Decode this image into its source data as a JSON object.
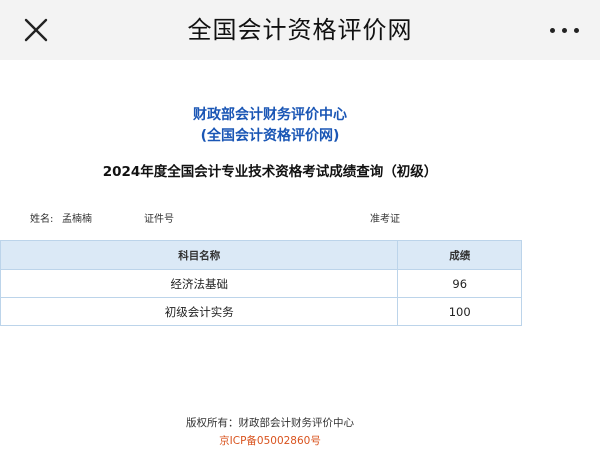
{
  "topbar": {
    "title": "全国会计资格评价网",
    "close_icon": "close-icon",
    "more_icon": "more-dots-icon"
  },
  "header": {
    "org_name": "财政部会计财务评价中心",
    "org_sub": "(全国会计资格评价网)",
    "heading": "2024年度全国会计专业技术资格考试成绩查询（初级）"
  },
  "candidate": {
    "name_label": "姓名:",
    "name_value": "孟楠楠",
    "id_label": "证件号",
    "ticket_label": "准考证"
  },
  "scores": {
    "headers": [
      "科目名称",
      "成绩"
    ],
    "rows": [
      {
        "subject": "经济法基础",
        "score": "96"
      },
      {
        "subject": "初级会计实务",
        "score": "100"
      }
    ]
  },
  "footer": {
    "copyright": "版权所有：财政部会计财务评价中心",
    "icp": "京ICP备05002860号"
  },
  "colors": {
    "topbar_bg": "#f3f3f3",
    "org_blue": "#1a56b5",
    "table_header_bg": "#dbe9f6",
    "icp_orange": "#d9531e"
  }
}
